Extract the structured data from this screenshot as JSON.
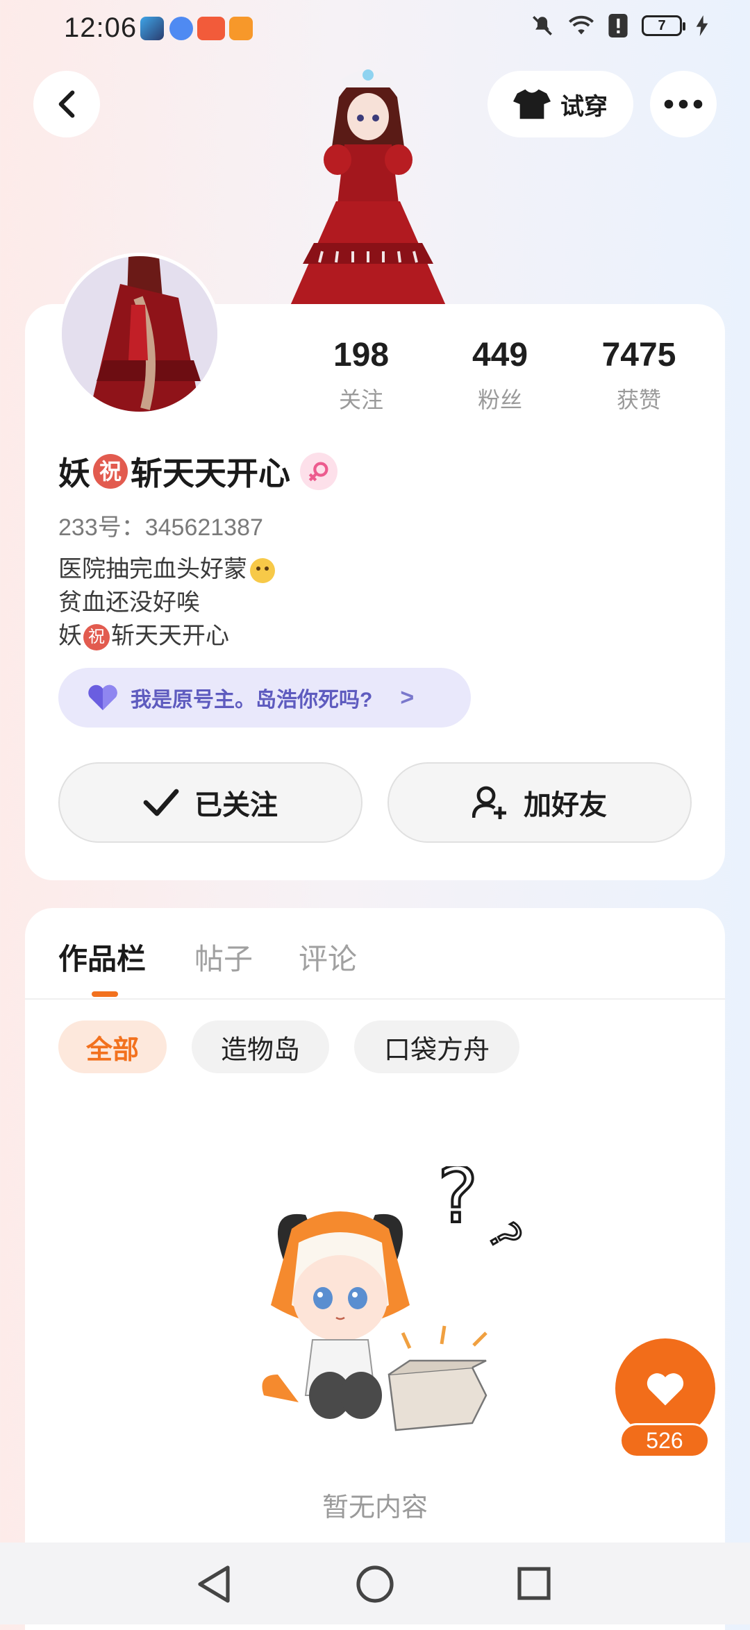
{
  "status_bar": {
    "time": "12:06",
    "battery": "7",
    "icons": [
      "game-app-icon",
      "music-app-icon",
      "xiaomi-store-icon",
      "video-app-icon",
      "mute-icon",
      "wifi-icon",
      "alert-icon",
      "battery-icon",
      "charging-icon"
    ]
  },
  "header": {
    "back_icon": "chevron-left-icon",
    "try_on_label": "试穿",
    "try_on_icon": "tshirt-icon",
    "more_icon": "more-dots-icon"
  },
  "profile": {
    "stats": [
      {
        "value": "198",
        "label": "关注"
      },
      {
        "value": "449",
        "label": "粉丝"
      },
      {
        "value": "7475",
        "label": "获赞"
      }
    ],
    "nickname_part1": "妖",
    "nickname_badge": "祝",
    "nickname_part2": "斩天天开心",
    "gender_icon": "female-icon",
    "uid": "233号：345621387",
    "bio_line1": "医院抽完血头好蒙",
    "bio_line2": "贫血还没好唉",
    "bio_line3_part1": "妖",
    "bio_line3_badge": "祝",
    "bio_line3_part2": "斩天天开心",
    "claim_text": "我是原号主。岛浩你死吗?",
    "claim_arrow": ">",
    "follow_label": "已关注",
    "add_friend_label": "加好友"
  },
  "works": {
    "tabs": [
      "作品栏",
      "帖子",
      "评论"
    ],
    "active_tab": 0,
    "chips": [
      "全部",
      "造物岛",
      "口袋方舟"
    ],
    "active_chip": 0,
    "empty_text": "暂无内容"
  },
  "like_fab": {
    "count": "526"
  },
  "colors": {
    "accent": "#f2711e",
    "claim_text": "#5e5bbf",
    "claim_bg": "#e9e8fb"
  }
}
